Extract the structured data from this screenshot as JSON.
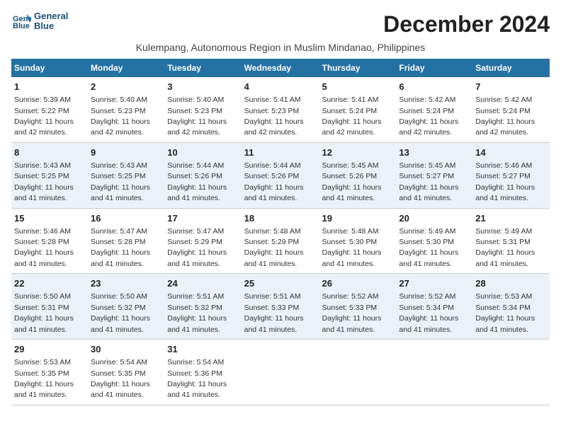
{
  "logo": {
    "line1": "General",
    "line2": "Blue"
  },
  "title": "December 2024",
  "subtitle": "Kulempang, Autonomous Region in Muslim Mindanao, Philippines",
  "days_header": [
    "Sunday",
    "Monday",
    "Tuesday",
    "Wednesday",
    "Thursday",
    "Friday",
    "Saturday"
  ],
  "weeks": [
    [
      {
        "day": "1",
        "sunrise": "Sunrise: 5:39 AM",
        "sunset": "Sunset: 5:22 PM",
        "daylight": "Daylight: 11 hours and 42 minutes."
      },
      {
        "day": "2",
        "sunrise": "Sunrise: 5:40 AM",
        "sunset": "Sunset: 5:23 PM",
        "daylight": "Daylight: 11 hours and 42 minutes."
      },
      {
        "day": "3",
        "sunrise": "Sunrise: 5:40 AM",
        "sunset": "Sunset: 5:23 PM",
        "daylight": "Daylight: 11 hours and 42 minutes."
      },
      {
        "day": "4",
        "sunrise": "Sunrise: 5:41 AM",
        "sunset": "Sunset: 5:23 PM",
        "daylight": "Daylight: 11 hours and 42 minutes."
      },
      {
        "day": "5",
        "sunrise": "Sunrise: 5:41 AM",
        "sunset": "Sunset: 5:24 PM",
        "daylight": "Daylight: 11 hours and 42 minutes."
      },
      {
        "day": "6",
        "sunrise": "Sunrise: 5:42 AM",
        "sunset": "Sunset: 5:24 PM",
        "daylight": "Daylight: 11 hours and 42 minutes."
      },
      {
        "day": "7",
        "sunrise": "Sunrise: 5:42 AM",
        "sunset": "Sunset: 5:24 PM",
        "daylight": "Daylight: 11 hours and 42 minutes."
      }
    ],
    [
      {
        "day": "8",
        "sunrise": "Sunrise: 5:43 AM",
        "sunset": "Sunset: 5:25 PM",
        "daylight": "Daylight: 11 hours and 41 minutes."
      },
      {
        "day": "9",
        "sunrise": "Sunrise: 5:43 AM",
        "sunset": "Sunset: 5:25 PM",
        "daylight": "Daylight: 11 hours and 41 minutes."
      },
      {
        "day": "10",
        "sunrise": "Sunrise: 5:44 AM",
        "sunset": "Sunset: 5:26 PM",
        "daylight": "Daylight: 11 hours and 41 minutes."
      },
      {
        "day": "11",
        "sunrise": "Sunrise: 5:44 AM",
        "sunset": "Sunset: 5:26 PM",
        "daylight": "Daylight: 11 hours and 41 minutes."
      },
      {
        "day": "12",
        "sunrise": "Sunrise: 5:45 AM",
        "sunset": "Sunset: 5:26 PM",
        "daylight": "Daylight: 11 hours and 41 minutes."
      },
      {
        "day": "13",
        "sunrise": "Sunrise: 5:45 AM",
        "sunset": "Sunset: 5:27 PM",
        "daylight": "Daylight: 11 hours and 41 minutes."
      },
      {
        "day": "14",
        "sunrise": "Sunrise: 5:46 AM",
        "sunset": "Sunset: 5:27 PM",
        "daylight": "Daylight: 11 hours and 41 minutes."
      }
    ],
    [
      {
        "day": "15",
        "sunrise": "Sunrise: 5:46 AM",
        "sunset": "Sunset: 5:28 PM",
        "daylight": "Daylight: 11 hours and 41 minutes."
      },
      {
        "day": "16",
        "sunrise": "Sunrise: 5:47 AM",
        "sunset": "Sunset: 5:28 PM",
        "daylight": "Daylight: 11 hours and 41 minutes."
      },
      {
        "day": "17",
        "sunrise": "Sunrise: 5:47 AM",
        "sunset": "Sunset: 5:29 PM",
        "daylight": "Daylight: 11 hours and 41 minutes."
      },
      {
        "day": "18",
        "sunrise": "Sunrise: 5:48 AM",
        "sunset": "Sunset: 5:29 PM",
        "daylight": "Daylight: 11 hours and 41 minutes."
      },
      {
        "day": "19",
        "sunrise": "Sunrise: 5:48 AM",
        "sunset": "Sunset: 5:30 PM",
        "daylight": "Daylight: 11 hours and 41 minutes."
      },
      {
        "day": "20",
        "sunrise": "Sunrise: 5:49 AM",
        "sunset": "Sunset: 5:30 PM",
        "daylight": "Daylight: 11 hours and 41 minutes."
      },
      {
        "day": "21",
        "sunrise": "Sunrise: 5:49 AM",
        "sunset": "Sunset: 5:31 PM",
        "daylight": "Daylight: 11 hours and 41 minutes."
      }
    ],
    [
      {
        "day": "22",
        "sunrise": "Sunrise: 5:50 AM",
        "sunset": "Sunset: 5:31 PM",
        "daylight": "Daylight: 11 hours and 41 minutes."
      },
      {
        "day": "23",
        "sunrise": "Sunrise: 5:50 AM",
        "sunset": "Sunset: 5:32 PM",
        "daylight": "Daylight: 11 hours and 41 minutes."
      },
      {
        "day": "24",
        "sunrise": "Sunrise: 5:51 AM",
        "sunset": "Sunset: 5:32 PM",
        "daylight": "Daylight: 11 hours and 41 minutes."
      },
      {
        "day": "25",
        "sunrise": "Sunrise: 5:51 AM",
        "sunset": "Sunset: 5:33 PM",
        "daylight": "Daylight: 11 hours and 41 minutes."
      },
      {
        "day": "26",
        "sunrise": "Sunrise: 5:52 AM",
        "sunset": "Sunset: 5:33 PM",
        "daylight": "Daylight: 11 hours and 41 minutes."
      },
      {
        "day": "27",
        "sunrise": "Sunrise: 5:52 AM",
        "sunset": "Sunset: 5:34 PM",
        "daylight": "Daylight: 11 hours and 41 minutes."
      },
      {
        "day": "28",
        "sunrise": "Sunrise: 5:53 AM",
        "sunset": "Sunset: 5:34 PM",
        "daylight": "Daylight: 11 hours and 41 minutes."
      }
    ],
    [
      {
        "day": "29",
        "sunrise": "Sunrise: 5:53 AM",
        "sunset": "Sunset: 5:35 PM",
        "daylight": "Daylight: 11 hours and 41 minutes."
      },
      {
        "day": "30",
        "sunrise": "Sunrise: 5:54 AM",
        "sunset": "Sunset: 5:35 PM",
        "daylight": "Daylight: 11 hours and 41 minutes."
      },
      {
        "day": "31",
        "sunrise": "Sunrise: 5:54 AM",
        "sunset": "Sunset: 5:36 PM",
        "daylight": "Daylight: 11 hours and 41 minutes."
      },
      null,
      null,
      null,
      null
    ]
  ]
}
